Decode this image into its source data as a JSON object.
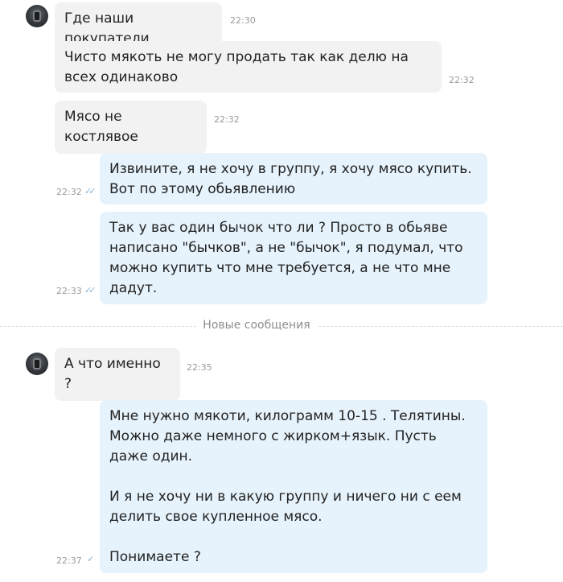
{
  "messages": [
    {
      "text": "Где наши покупатели",
      "time": "22:30"
    },
    {
      "text": "Чисто мякоть не могу продать так как делю на всех одинаково",
      "time": "22:32"
    },
    {
      "text": "Мясо не костлявое",
      "time": "22:32"
    },
    {
      "text": "Извините, я не хочу в группу, я хочу мясо купить. Вот по этому обьявлению",
      "time": "22:32"
    },
    {
      "text": "Так у вас один бычок что ли ? Просто в обьяве написано \"бычков\", а не \"бычок\", я подумал, что можно купить что мне требуется, а не что мне дадут.",
      "time": "22:33"
    },
    {
      "text": "А что именно ?",
      "time": "22:35"
    },
    {
      "text": "Мне нужно мякоти, килограмм 10-15 . Телятины. Можно даже немного с жирком+язык. Пусть даже один.\n\nИ я не хочу ни в какую группу и ничего ни с еем делить свое купленное мясо.\n\nПонимаете ?",
      "time": "22:37"
    }
  ],
  "divider": {
    "label": "Новые сообщения"
  },
  "icons": {
    "read_receipt": "double-check-icon",
    "sent_receipt": "single-check-icon"
  },
  "colors": {
    "incoming_bubble": "#f2f2f2",
    "outgoing_bubble": "#e6f3fc",
    "check": "#8ab4d6"
  }
}
